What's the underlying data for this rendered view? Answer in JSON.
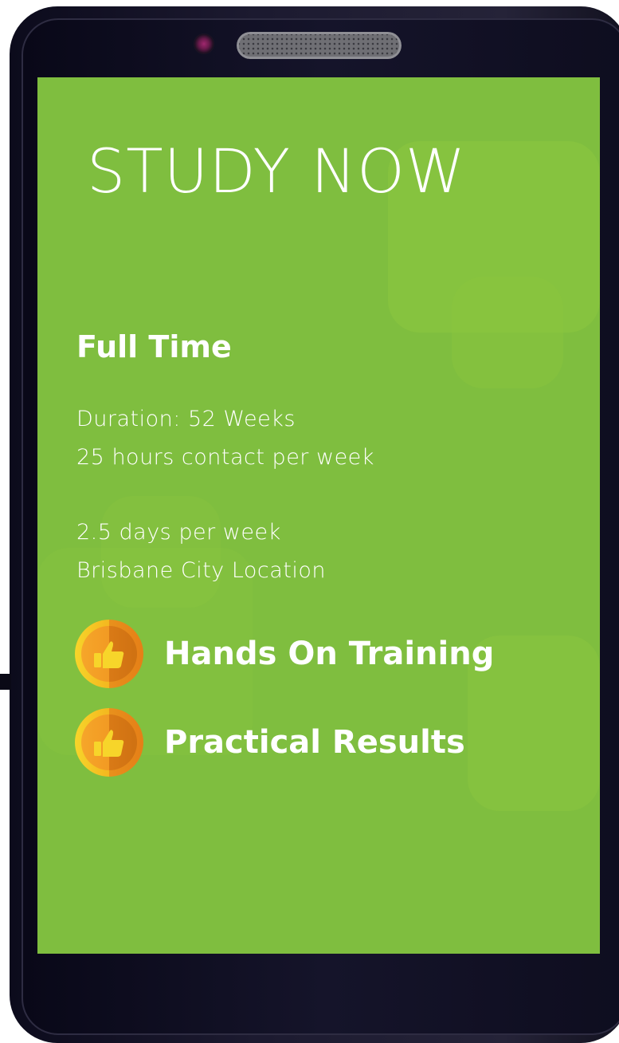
{
  "screen": {
    "title": "STUDY NOW",
    "section_heading": "Full Time",
    "info_lines": [
      "Duration: 52 Weeks",
      "25 hours contact per week",
      "2.5 days per week",
      "Brisbane City Location"
    ],
    "features": [
      {
        "label": "Hands On Training",
        "icon": "thumbs-up-icon"
      },
      {
        "label": "Practical Results",
        "icon": "thumbs-up-icon"
      }
    ]
  },
  "colors": {
    "screen_green": "#7fbe3f",
    "badge_yellow": "#f7d52a",
    "badge_orange": "#e57f17",
    "phone_body": "#1c1a30"
  }
}
